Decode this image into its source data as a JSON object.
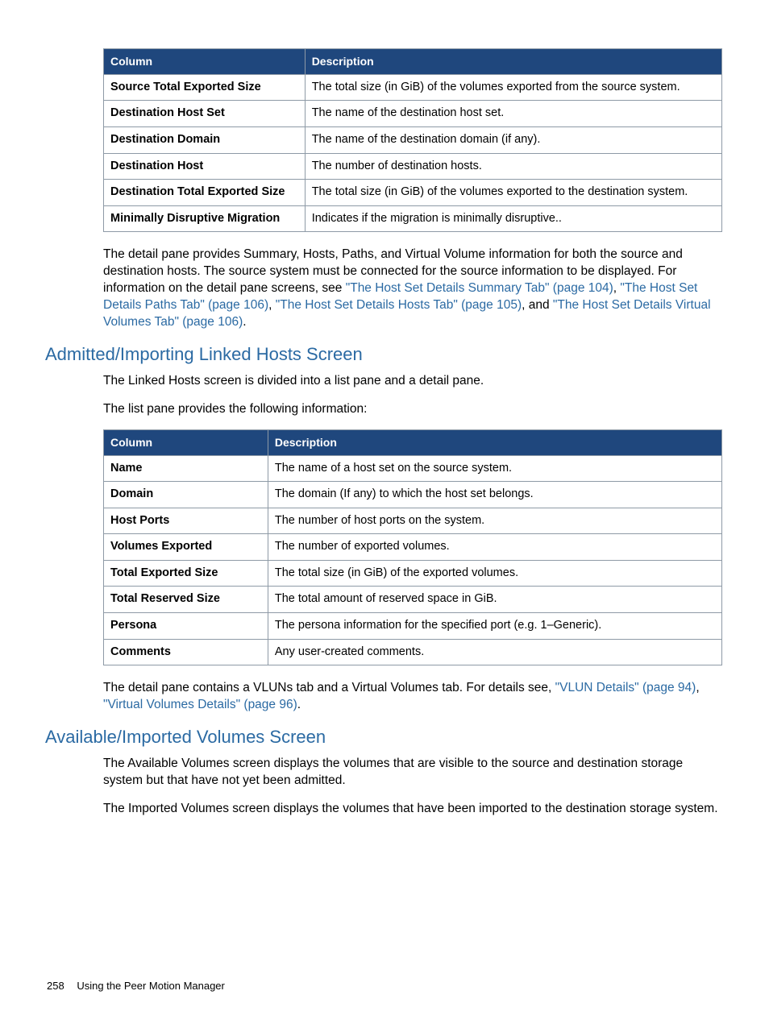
{
  "table1": {
    "headCol1": "Column",
    "headCol2": "Description",
    "rows": [
      {
        "c": "Source Total Exported Size",
        "d": "The total size (in GiB) of the volumes exported from the source system."
      },
      {
        "c": "Destination Host Set",
        "d": "The name of the destination host set."
      },
      {
        "c": "Destination Domain",
        "d": "The name of the destination domain (if any)."
      },
      {
        "c": "Destination Host",
        "d": "The number of destination hosts."
      },
      {
        "c": "Destination Total Exported Size",
        "d": "The total size (in GiB) of the volumes exported to the destination system."
      },
      {
        "c": "Minimally Disruptive Migration",
        "d": "Indicates if the migration is minimally disruptive.."
      }
    ]
  },
  "para1_pre": "The detail pane provides Summary, Hosts, Paths, and Virtual Volume information for both the source and destination hosts. The source system must be connected for the source information to be displayed. For information on the detail pane screens, see ",
  "link1": "\"The Host Set Details Summary Tab\" (page 104)",
  "sep1": ", ",
  "link2": "\"The Host Set Details Paths Tab\" (page 106)",
  "sep2": ", ",
  "link3": "\"The Host Set Details Hosts Tab\" (page 105)",
  "sep3": ", and ",
  "link4": "\"The Host Set Details Virtual Volumes Tab\" (page 106)",
  "para1_post": ".",
  "heading1": "Admitted/Importing Linked Hosts Screen",
  "para2": "The Linked Hosts screen is divided into a list pane and a detail pane.",
  "para3": "The list pane provides the following information:",
  "table2": {
    "headCol1": "Column",
    "headCol2": "Description",
    "rows": [
      {
        "c": "Name",
        "d": "The name of a host set on the source system."
      },
      {
        "c": "Domain",
        "d": "The domain (If any) to which the host set belongs."
      },
      {
        "c": "Host Ports",
        "d": "The number of host ports on the system."
      },
      {
        "c": "Volumes Exported",
        "d": "The number of exported volumes."
      },
      {
        "c": "Total Exported Size",
        "d": "The total size (in GiB) of the exported volumes."
      },
      {
        "c": "Total Reserved Size",
        "d": "The total amount of reserved space in GiB."
      },
      {
        "c": "Persona",
        "d": "The persona information for the specified port (e.g. 1–Generic)."
      },
      {
        "c": "Comments",
        "d": "Any user-created comments."
      }
    ]
  },
  "para4_pre": "The detail pane contains a VLUNs tab and a Virtual Volumes tab. For details see, ",
  "link5": "\"VLUN Details\" (page 94)",
  "sep5": ", ",
  "link6": "\"Virtual Volumes Details\" (page 96)",
  "para4_post": ".",
  "heading2": "Available/Imported Volumes Screen",
  "para5": "The Available Volumes screen displays the volumes that are visible to the source and destination storage system but that have not yet been admitted.",
  "para6": "The Imported Volumes screen displays the volumes that have been imported to the destination storage system.",
  "footer_page": "258",
  "footer_title": "Using the Peer Motion Manager"
}
